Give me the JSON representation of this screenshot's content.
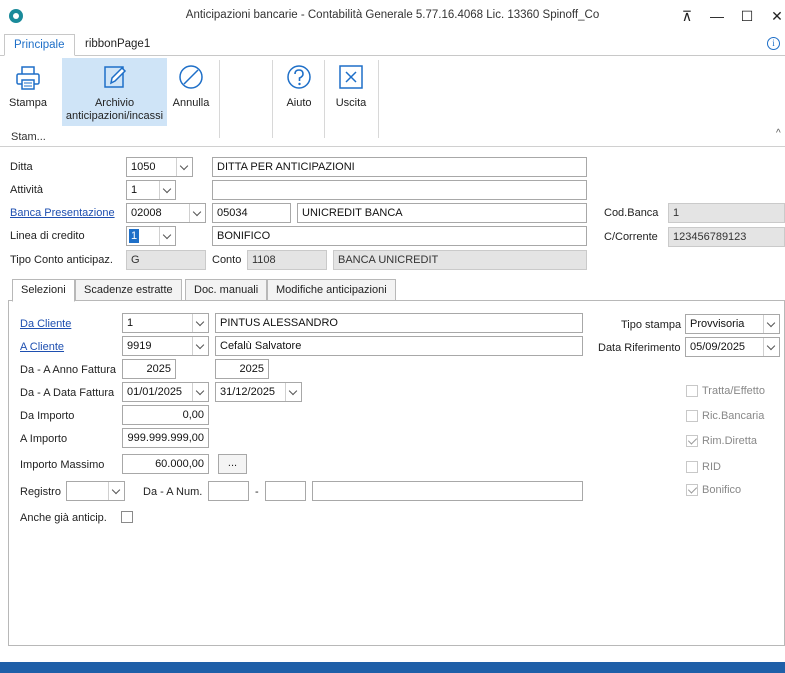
{
  "window": {
    "title": "Anticipazioni bancarie - Contabilità Generale 5.77.16.4068 Lic. 13360 Spinoff_Co",
    "controls": [
      "⊼",
      "—",
      "☐",
      "✕"
    ]
  },
  "ribbon": {
    "tabs": [
      "Principale",
      "ribbonPage1"
    ],
    "group_label": "Stam...",
    "buttons": {
      "stampa": "Stampa",
      "archivio_l1": "Archivio",
      "archivio_l2": "anticipazioni/incassi",
      "annulla": "Annulla",
      "aiuto": "Aiuto",
      "uscita": "Uscita"
    }
  },
  "header_form": {
    "ditta": {
      "label": "Ditta",
      "code": "1050",
      "name": "DITTA PER ANTICIPAZIONI"
    },
    "attivita": {
      "label": "Attività",
      "code": "1",
      "name": ""
    },
    "banca": {
      "label": "Banca Presentazione",
      "abi": "02008",
      "cab": "05034",
      "name": "UNICREDIT BANCA"
    },
    "linea": {
      "label": "Linea di credito",
      "code": "1",
      "name": "BONIFICO"
    },
    "tipo_conto": {
      "label": "Tipo Conto anticipaz.",
      "value": "G"
    },
    "conto": {
      "label": "Conto",
      "code": "1108",
      "name": "BANCA UNICREDIT"
    },
    "cod_banca": {
      "label": "Cod.Banca",
      "value": "1"
    },
    "c_corrente": {
      "label": "C/Corrente",
      "value": "123456789123"
    }
  },
  "tabs": [
    "Selezioni",
    "Scadenze estratte",
    "Doc. manuali",
    "Modifiche anticipazioni"
  ],
  "selezioni": {
    "da_cliente": {
      "label": "Da Cliente",
      "code": "1",
      "name": "PINTUS ALESSANDRO"
    },
    "a_cliente": {
      "label": "A Cliente",
      "code": "9919",
      "name": "Cefalù Salvatore"
    },
    "anno_fattura": {
      "label": "Da - A Anno Fattura",
      "from": "2025",
      "to": "2025"
    },
    "data_fattura": {
      "label": "Da - A Data Fattura",
      "from": "01/01/2025",
      "to": "31/12/2025"
    },
    "da_importo": {
      "label": "Da Importo",
      "value": "0,00"
    },
    "a_importo": {
      "label": "A Importo",
      "value": "999.999.999,00"
    },
    "importo_massimo": {
      "label": "Importo Massimo",
      "value": "60.000,00",
      "button": "..."
    },
    "registro": {
      "label": "Registro",
      "value": ""
    },
    "num": {
      "label": "Da - A Num.",
      "from": "",
      "separator": "-",
      "to": "",
      "extra": ""
    },
    "anche_gia": {
      "label": "Anche già anticip."
    },
    "tipo_stampa": {
      "label": "Tipo stampa",
      "value": "Provvisoria"
    },
    "data_riferimento": {
      "label": "Data Riferimento",
      "value": "05/09/2025"
    },
    "checks": {
      "tratta": "Tratta/Effetto",
      "ric_bancaria": "Ric.Bancaria",
      "rim_diretta": "Rim.Diretta",
      "rid": "RID",
      "bonifico": "Bonifico"
    }
  }
}
